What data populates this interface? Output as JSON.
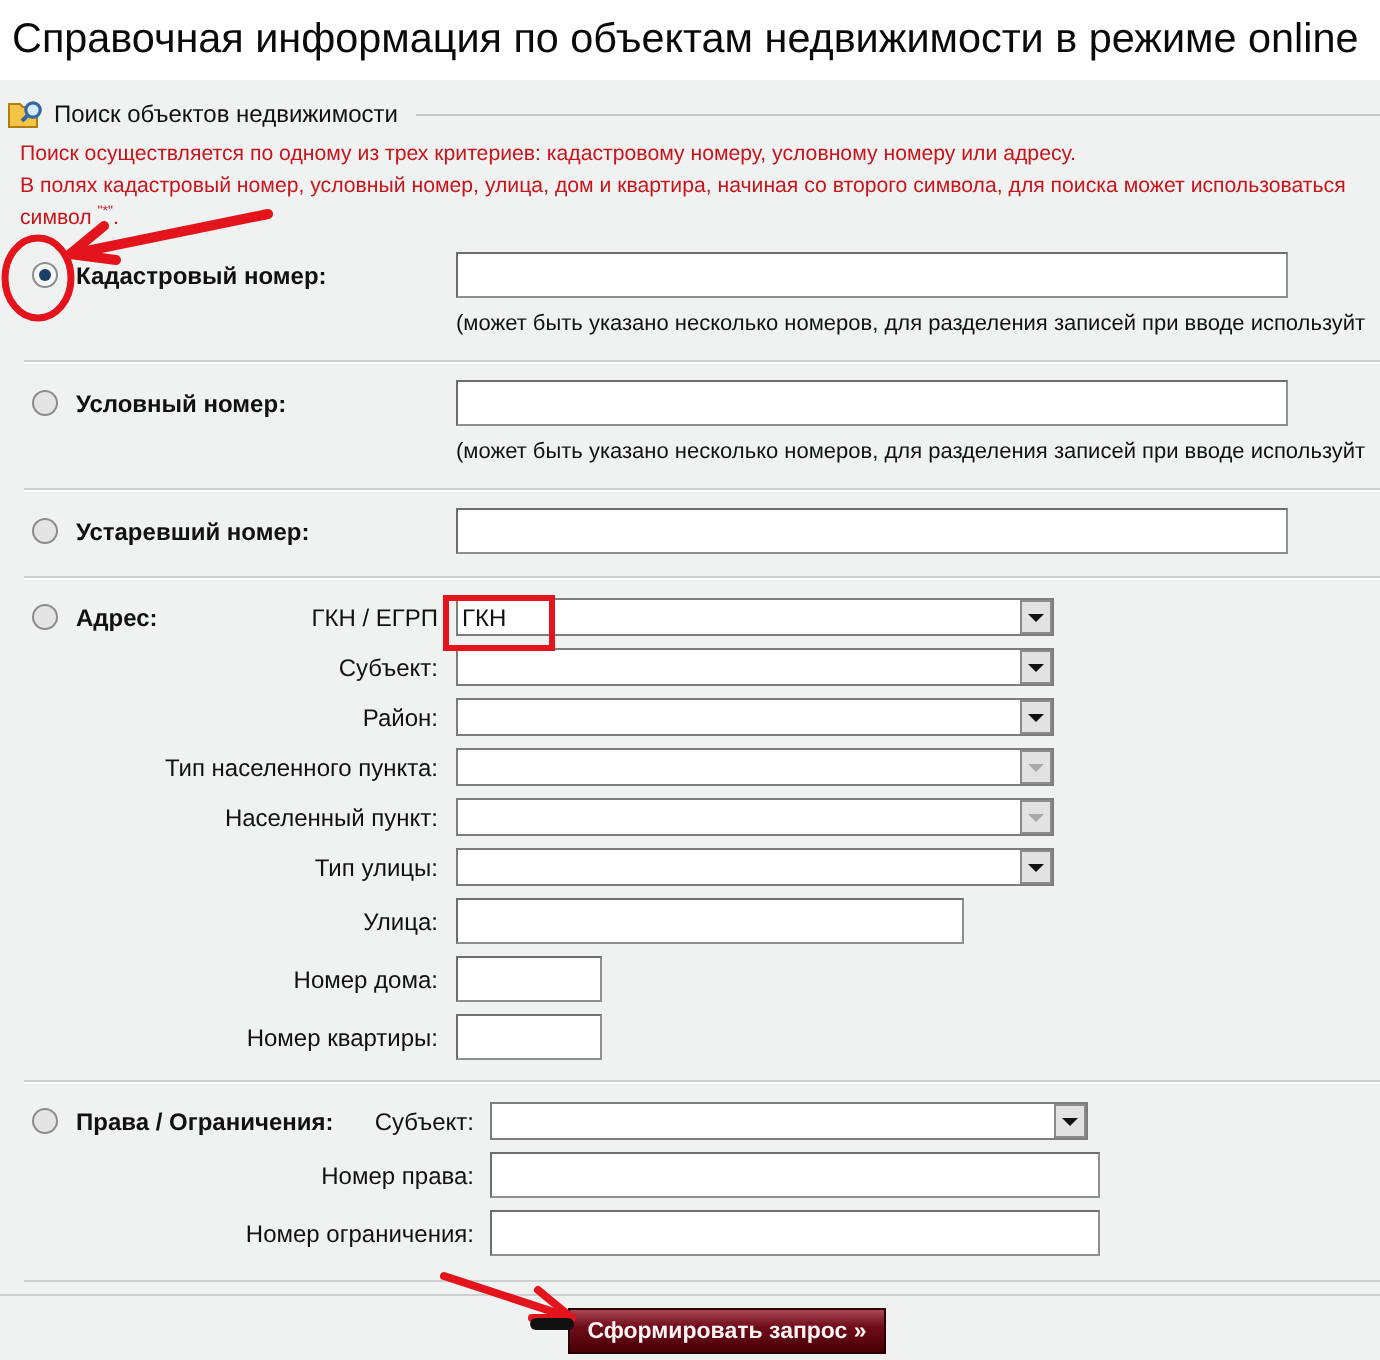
{
  "title": "Справочная информация по объектам недвижимости в режиме online",
  "search": {
    "legend": "Поиск объектов недвижимости",
    "notes": [
      "Поиск осуществляется по одному из трех критериев: кадастровому номеру, условному номеру или адресу.",
      "В полях кадастровый номер, условный номер, улица, дом и квартира, начиная со второго символа, для поиска может использоваться символ $^{\"*\"}$."
    ],
    "criteria": [
      {
        "kind": "number",
        "label": "Кадастровый номер:",
        "selected": true,
        "hint": "(может быть указано несколько номеров, для разделения записей при вводе используйт"
      },
      {
        "kind": "number",
        "label": "Условный номер:",
        "selected": false,
        "hint": "(может быть указано несколько номеров, для разделения записей при вводе используйт"
      },
      {
        "kind": "number",
        "label": "Устаревший номер:",
        "selected": false
      },
      {
        "kind": "address",
        "label": "Адрес:",
        "selected": false,
        "fields": [
          {
            "kind": "select",
            "label": "ГКН / ЕГРП",
            "value": "ГКН",
            "disabled": false
          },
          {
            "kind": "select",
            "label": "Субъект:",
            "disabled": false
          },
          {
            "kind": "select",
            "label": "Район:",
            "disabled": false
          },
          {
            "kind": "select",
            "label": "Тип населенного пункта:",
            "disabled": true
          },
          {
            "kind": "select",
            "label": "Населенный пункт:",
            "disabled": true
          },
          {
            "kind": "select",
            "label": "Тип улицы:",
            "disabled": false
          },
          {
            "kind": "input",
            "label": "Улица:"
          },
          {
            "kind": "short",
            "label": "Номер дома:"
          },
          {
            "kind": "short",
            "label": "Номер квартиры:"
          }
        ]
      },
      {
        "kind": "rights",
        "label": "Права / Ограничения:",
        "selected": false,
        "fields": [
          {
            "kind": "select",
            "label": "Субъект:",
            "disabled": false
          },
          {
            "kind": "input",
            "label": "Номер права:"
          },
          {
            "kind": "input",
            "label": "Номер ограничения:"
          }
        ]
      }
    ]
  },
  "submit_button": "Сформировать запрос »"
}
